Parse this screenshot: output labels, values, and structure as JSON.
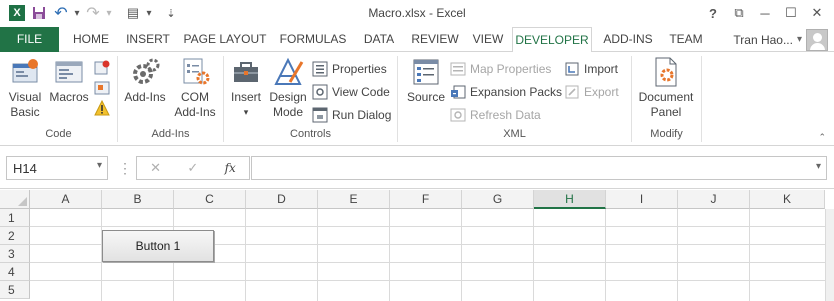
{
  "window": {
    "title": "Macro.xlsx - Excel",
    "controls": [
      "?",
      "⧉",
      "─",
      "☐",
      "✕"
    ]
  },
  "qat": {
    "excel_icon": "X",
    "save": "💾",
    "undo": "↶",
    "undo_dd": "▾",
    "redo": "↷",
    "redo_dd": "▾",
    "form": "▤",
    "form_dd": "▾",
    "customize": "⇣"
  },
  "tabs": [
    {
      "label": "FILE"
    },
    {
      "label": "HOME"
    },
    {
      "label": "INSERT"
    },
    {
      "label": "PAGE LAYOUT"
    },
    {
      "label": "FORMULAS"
    },
    {
      "label": "DATA"
    },
    {
      "label": "REVIEW"
    },
    {
      "label": "VIEW"
    },
    {
      "label": "DEVELOPER"
    },
    {
      "label": "ADD-INS"
    },
    {
      "label": "TEAM"
    }
  ],
  "user": {
    "name": "Tran Hao...",
    "dropdown": "▾"
  },
  "ribbon": {
    "code": {
      "label": "Code",
      "visual_basic": [
        "Visual",
        "Basic"
      ],
      "macros": "Macros"
    },
    "addins": {
      "label": "Add-Ins",
      "addins": "Add-Ins",
      "com_addins": [
        "COM",
        "Add-Ins"
      ]
    },
    "controls": {
      "label": "Controls",
      "insert": "Insert",
      "insert_dd": "▾",
      "design_mode": [
        "Design",
        "Mode"
      ],
      "properties": "Properties",
      "view_code": "View Code",
      "run_dialog": "Run Dialog"
    },
    "xml": {
      "label": "XML",
      "source": "Source",
      "map_properties": "Map Properties",
      "expansion_packs": "Expansion Packs",
      "refresh_data": "Refresh Data",
      "import": "Import",
      "export": "Export"
    },
    "modify": {
      "label": "Modify",
      "document_panel": [
        "Document",
        "Panel"
      ]
    },
    "collapse": "⌃"
  },
  "formula_bar": {
    "name_box": "H14",
    "name_box_dd": "▾",
    "separator": "⋮",
    "cancel": "✕",
    "enter": "✓",
    "fx": "fx",
    "value": "",
    "expand": "▾"
  },
  "grid": {
    "columns": [
      "A",
      "B",
      "C",
      "D",
      "E",
      "F",
      "G",
      "H",
      "I",
      "J",
      "K"
    ],
    "selected_column": "H",
    "rows": [
      "1",
      "2",
      "3",
      "4",
      "5"
    ],
    "form_button_label": "Button 1"
  },
  "colors": {
    "excel_green": "#217346",
    "accent_orange": "#e8762b"
  }
}
